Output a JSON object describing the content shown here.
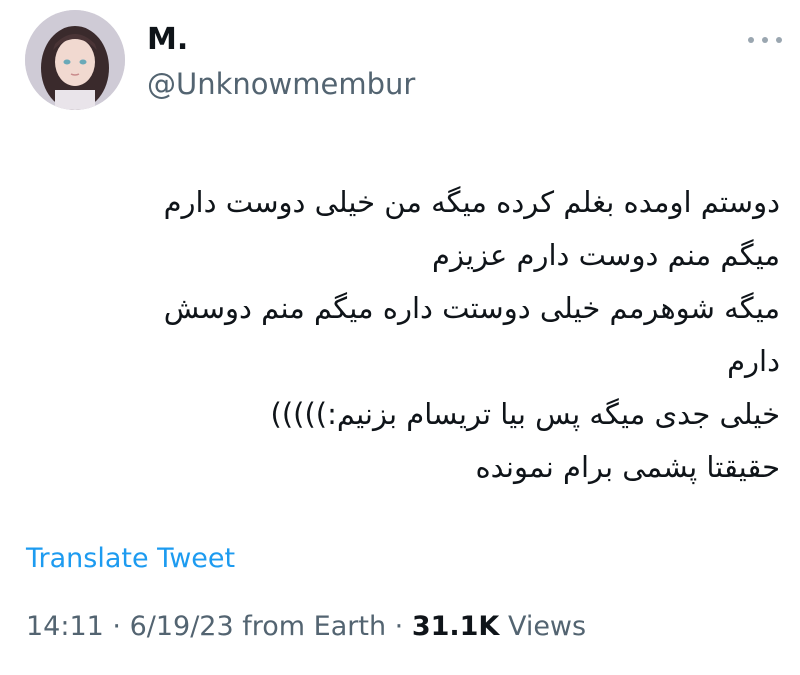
{
  "author": {
    "name": "M.",
    "handle": "@Unknowmembur"
  },
  "tweet": {
    "lines": [
      "دوستم اومده بغلم کرده میگه من خیلی دوست دارم",
      "میگم منم دوست دارم عزیزم",
      "میگه شوهرمم خیلی دوستت داره میگم منم دوسش",
      "دارم",
      "خیلی جدی میگه پس بیا تریسام بزنیم:)))))",
      "حقیقتا پشمی برام نمونده"
    ],
    "translate_label": "Translate Tweet"
  },
  "meta": {
    "time": "14:11",
    "sep1": " · ",
    "date": "6/19/23",
    "source": " from Earth",
    "sep2": " · ",
    "views_count": "31.1K",
    "views_label": " Views"
  },
  "colors": {
    "link": "#1d9bf0",
    "secondary_text": "#536471",
    "primary_text": "#0f1419"
  },
  "icons": {
    "more": "more-horizontal-icon"
  }
}
